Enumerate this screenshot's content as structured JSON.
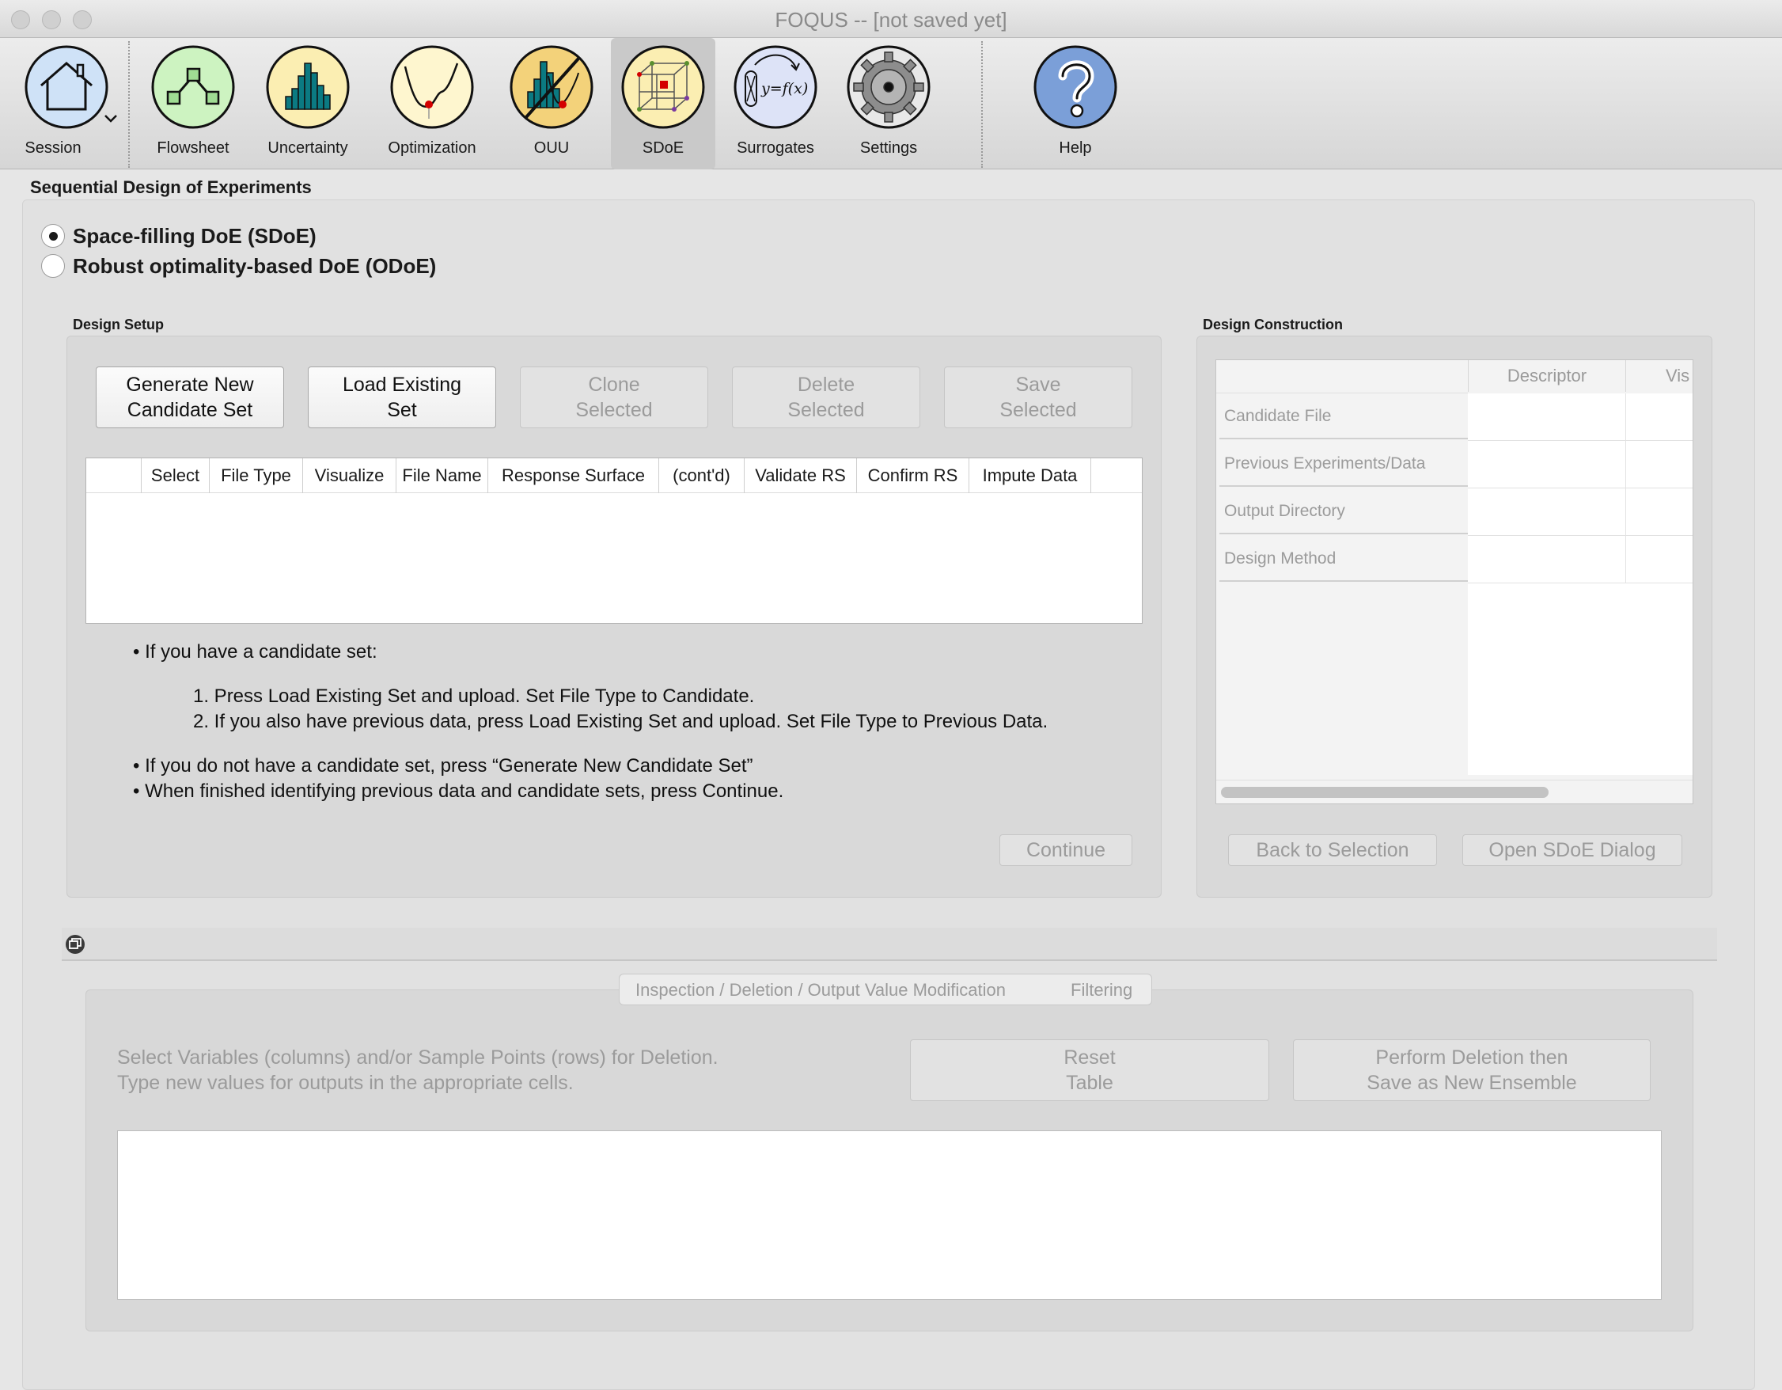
{
  "window": {
    "title": "FOQUS -- [not saved yet]"
  },
  "toolbar": {
    "session": "Session",
    "flowsheet": "Flowsheet",
    "uncertainty": "Uncertainty",
    "optimization": "Optimization",
    "ouu": "OUU",
    "sdoe": "SDoE",
    "surrogates": "Surrogates",
    "settings": "Settings",
    "help": "Help"
  },
  "page": {
    "title": "Sequential Design of Experiments"
  },
  "mode": {
    "sdoe": "Space-filling DoE (SDoE)",
    "odoe": "Robust optimality-based DoE (ODoE)",
    "selected": "sdoe"
  },
  "design_setup": {
    "title": "Design Setup",
    "buttons": {
      "generate": "Generate New\nCandidate Set",
      "load": "Load Existing\nSet",
      "clone": "Clone\nSelected",
      "delete": "Delete\nSelected",
      "save": "Save\nSelected"
    },
    "columns": [
      "",
      "Select",
      "File Type",
      "Visualize",
      "File Name",
      "Response Surface",
      "(cont'd)",
      "Validate RS",
      "Confirm RS",
      "Impute Data"
    ],
    "instructions": {
      "bullet1": "If you have a candidate set:",
      "step1": "1. Press Load Existing Set and upload. Set File Type to Candidate.",
      "step2": "2. If you also have previous data, press Load Existing Set and upload. Set File Type to Previous Data.",
      "bullet2": "If you do not have a candidate set, press “Generate New Candidate Set”",
      "bullet3": "When finished identifying previous data and candidate sets, press Continue."
    },
    "continue": "Continue"
  },
  "design_construction": {
    "title": "Design Construction",
    "columns": [
      "Descriptor",
      "Vis"
    ],
    "rows": [
      "Candidate File",
      "Previous Experiments/Data",
      "Output Directory",
      "Design Method"
    ],
    "back": "Back to Selection",
    "open": "Open SDoE Dialog"
  },
  "bottom": {
    "tabs": [
      "Inspection / Deletion / Output Value Modification",
      "Filtering"
    ],
    "instruction1": "Select Variables (columns) and/or Sample Points (rows) for Deletion.",
    "instruction2": "Type new values for outputs in the appropriate cells.",
    "reset": "Reset\nTable",
    "perform": "Perform Deletion then\nSave as New Ensemble"
  }
}
